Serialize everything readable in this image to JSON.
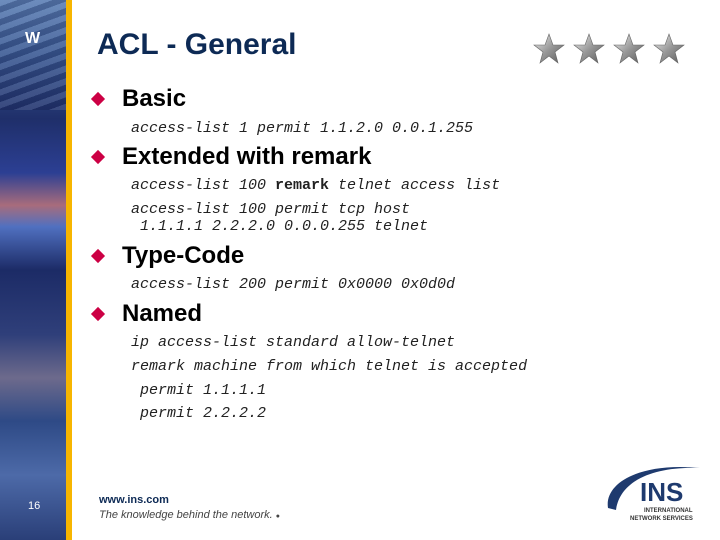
{
  "sidebar": {
    "logo_letter": "W",
    "page_number": "16"
  },
  "header": {
    "title": "ACL - General",
    "star_count": 4
  },
  "sections": [
    {
      "heading": "Basic",
      "code_lines": [
        "access-list 1 permit 1.1.2.0 0.0.1.255"
      ]
    },
    {
      "heading": "Extended with remark",
      "code_lines": [
        {
          "pre": "access-list 100 ",
          "bold": "remark",
          "post": " telnet access list"
        },
        "access-list 100 permit tcp host",
        " 1.1.1.1 2.2.2.0 0.0.0.255 telnet"
      ]
    },
    {
      "heading": "Type-Code",
      "code_lines": [
        "access-list 200 permit 0x0000 0x0d0d"
      ]
    },
    {
      "heading": "Named",
      "code_lines": [
        "ip access-list standard allow-telnet",
        "remark machine from which telnet is accepted",
        " permit 1.1.1.1",
        " permit 2.2.2.2"
      ]
    }
  ],
  "footer": {
    "url": "www.ins.com",
    "tagline": "The knowledge behind the network.",
    "logo_main": "INS",
    "logo_sub1": "INTERNATIONAL",
    "logo_sub2": "NETWORK SERVICES"
  },
  "colors": {
    "accent_bar": "#f7b500",
    "bullet": "#cc0044",
    "title": "#0d2a55"
  }
}
